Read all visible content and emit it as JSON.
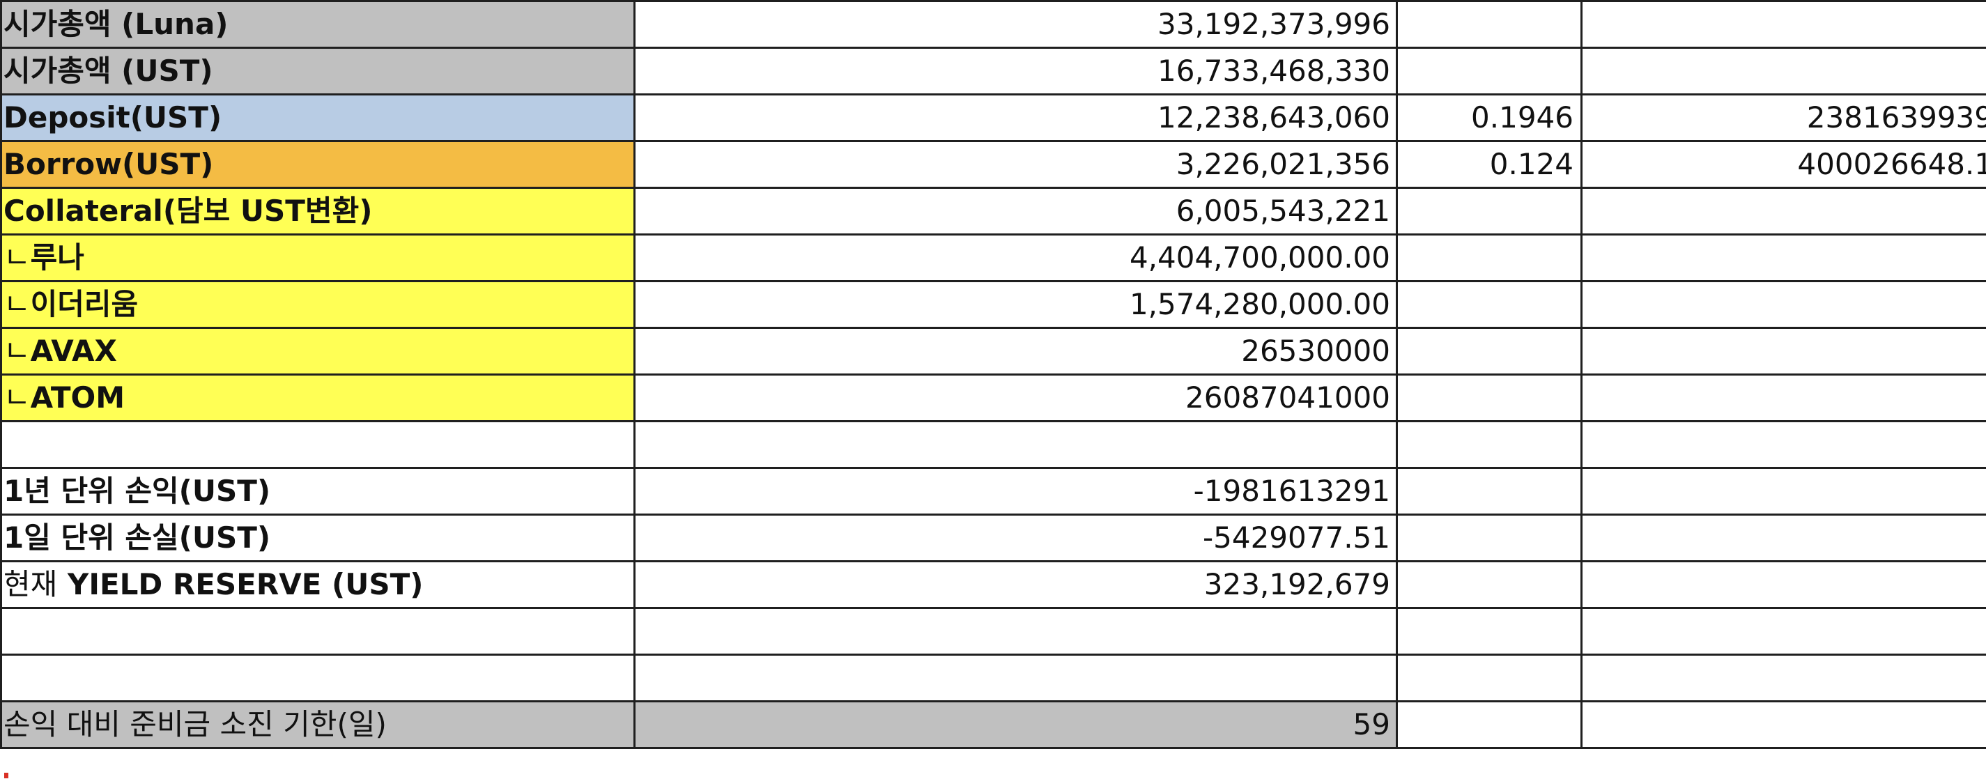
{
  "rows": [
    {
      "label": "시가총액 (Luna)",
      "value": "33,192,373,996",
      "rate": "",
      "amount": ""
    },
    {
      "label": "시가총액 (UST)",
      "value": "16,733,468,330",
      "rate": "",
      "amount": ""
    },
    {
      "label": "Deposit(UST)",
      "value": "12,238,643,060",
      "rate": "0.1946",
      "amount": "2381639939"
    },
    {
      "label": "Borrow(UST)",
      "value": "3,226,021,356",
      "rate": "0.124",
      "amount": "400026648.1"
    },
    {
      "label": "Collateral(담보 UST변환)",
      "value": "6,005,543,221",
      "rate": "",
      "amount": ""
    },
    {
      "label_prefix": "ㄴ",
      "label": "루나",
      "value": "4,404,700,000.00",
      "rate": "",
      "amount": ""
    },
    {
      "label_prefix": "ㄴ",
      "label": "이더리움",
      "value": "1,574,280,000.00",
      "rate": "",
      "amount": ""
    },
    {
      "label_prefix": "ㄴ",
      "label": "AVAX",
      "value": "26530000",
      "rate": "",
      "amount": ""
    },
    {
      "label_prefix": "ㄴ",
      "label": "ATOM",
      "value": "26087041000",
      "rate": "",
      "amount": ""
    },
    {
      "label": "",
      "value": "",
      "rate": "",
      "amount": ""
    },
    {
      "label": "1년 단위 손익(UST)",
      "value": "-1981613291",
      "rate": "",
      "amount": ""
    },
    {
      "label": "1일 단위 손실(UST)",
      "value": "-5429077.51",
      "rate": "",
      "amount": ""
    },
    {
      "label_prefix": "현재",
      "label": "YIELD RESERVE (UST)",
      "value": "323,192,679",
      "rate": "",
      "amount": ""
    },
    {
      "label": "",
      "value": "",
      "rate": "",
      "amount": ""
    },
    {
      "label": "",
      "value": "",
      "rate": "",
      "amount": ""
    },
    {
      "label": "손익 대비 준비금 소진 기한(일)",
      "value": "59",
      "rate": "",
      "amount": ""
    }
  ],
  "colors": {
    "grey": "#c0c0c0",
    "blue": "#b8cce4",
    "orange": "#f4bc44",
    "yellow": "#ffff55",
    "grid": "#1f1f1f"
  }
}
